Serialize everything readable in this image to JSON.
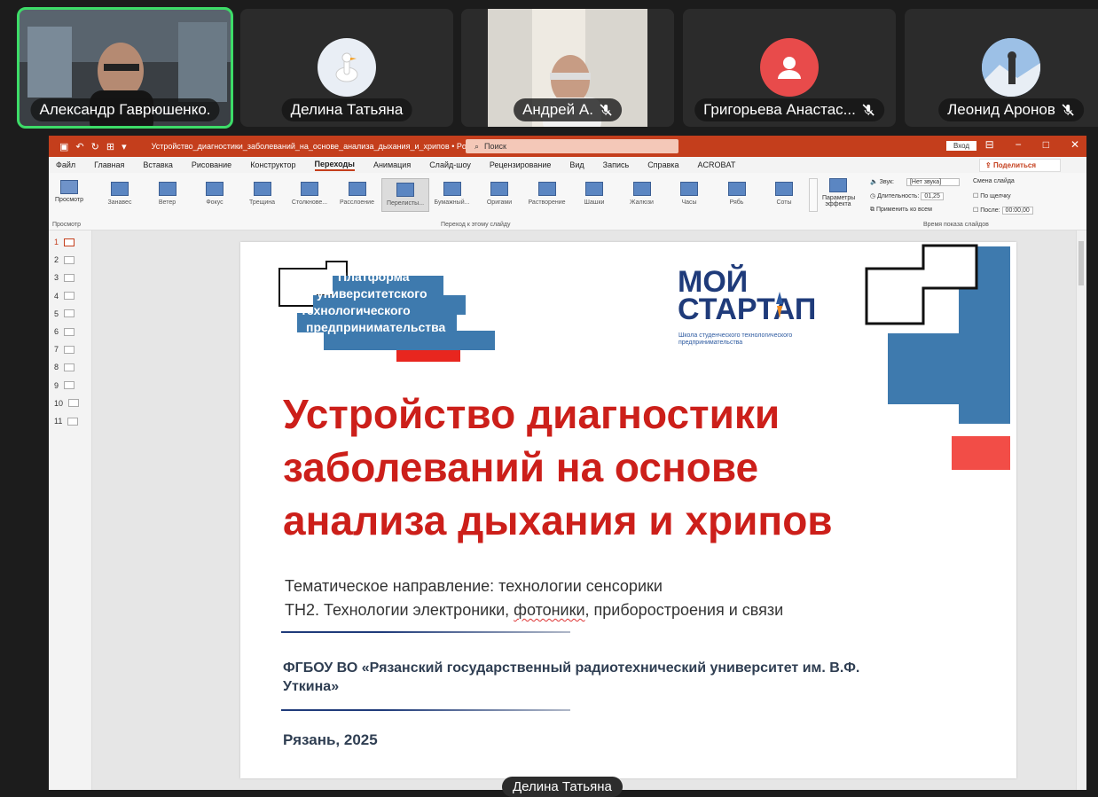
{
  "participants": [
    {
      "name": "Александр Гаврюшенко.",
      "muted": false,
      "active": true
    },
    {
      "name": "Делина Татьяна",
      "muted": false,
      "active": false,
      "avatar": "goose-icon",
      "avatar_bg": "#e9eef5"
    },
    {
      "name": "Андрей А.",
      "muted": true,
      "active": false
    },
    {
      "name": "Григорьева Анастас...",
      "muted": true,
      "active": false,
      "avatar": "person-icon",
      "avatar_bg": "#e84b4b"
    },
    {
      "name": "Леонид Аронов",
      "muted": true,
      "active": false
    }
  ],
  "ppt": {
    "window_title": "Устройство_диагностики_заболеваний_на_основе_анализа_дыхания_и_хрипов • PowerPoint",
    "search_placeholder": "Поиск",
    "signin_label": "Вход",
    "share_label": "Поделиться",
    "menu": [
      "Файл",
      "Главная",
      "Вставка",
      "Рисование",
      "Конструктор",
      "Переходы",
      "Анимация",
      "Слайд-шоу",
      "Рецензирование",
      "Вид",
      "Запись",
      "Справка",
      "ACROBAT"
    ],
    "menu_selected": "Переходы",
    "preview_label": "Просмотр",
    "preview_group": "Просмотр",
    "transitions": [
      "Занавес",
      "Ветер",
      "Фокус",
      "Трещина",
      "Столкнове...",
      "Расслоение",
      "Перелисты...",
      "Бумажный...",
      "Оригами",
      "Растворение",
      "Шашки",
      "Жалюзи",
      "Часы",
      "Рябь",
      "Соты"
    ],
    "transition_selected": "Перелисты...",
    "transition_group": "Переход к этому слайду",
    "effect_params": "Параметры эффекта",
    "sound_label": "Звук:",
    "sound_value": "[Нет звука]",
    "duration_label": "Длительность:",
    "duration_value": "01,25",
    "apply_all": "Применить ко всем",
    "advance_label": "Смена слайда",
    "on_click": "По щелчку",
    "after_label": "После:",
    "after_value": "00:00,00",
    "timing_group": "Время показа слайдов",
    "slides": [
      "1",
      "2",
      "3",
      "4",
      "5",
      "6",
      "7",
      "8",
      "9",
      "10",
      "11"
    ]
  },
  "slide": {
    "platform_logo": [
      "Платформа",
      "университетского",
      "технологического",
      "предпринимательства"
    ],
    "moi_logo": [
      "МОЙ",
      "СТАРТАП"
    ],
    "moi_sub": "Школа студенческого технологического предпринимательства",
    "title": "Устройство диагностики заболеваний на основе анализа дыхания и хрипов",
    "direction": "Тематическое направление: технологии сенсорики",
    "tn_prefix": "ТН2. Технологии электроники, ",
    "tn_word": "фотоники",
    "tn_suffix": ", приборостроения и связи",
    "org": "ФГБОУ ВО «Рязанский государственный радиотехнический университет им. В.Ф. Уткина»",
    "city": "Рязань, 2025"
  },
  "floating_name": "Делина Татьяна",
  "colors": {
    "accent": "#c43e1c",
    "title_red": "#cc1f1a",
    "blue": "#3e7aae",
    "active_green": "#3ddc68"
  }
}
